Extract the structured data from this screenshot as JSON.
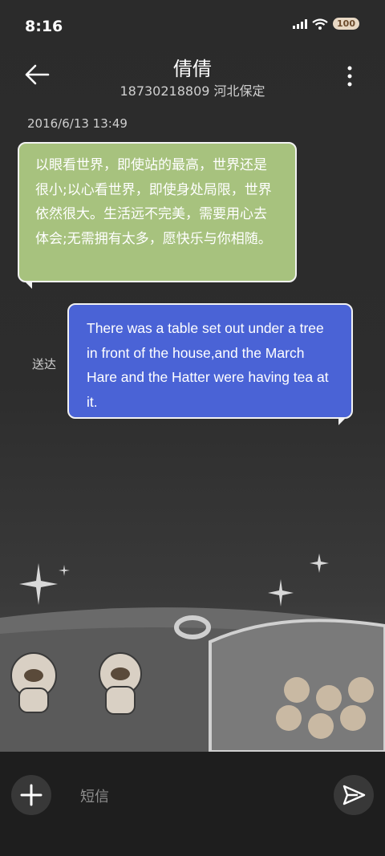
{
  "status_bar": {
    "time": "8:16",
    "battery_level": "100",
    "icons": [
      "signal-icon",
      "wifi-icon",
      "battery-icon"
    ]
  },
  "header": {
    "contact_name": "倩倩",
    "subtitle": "18730218809 河北保定",
    "back_icon": "back-arrow-icon",
    "menu_icon": "more-vertical-icon"
  },
  "messages": [
    {
      "direction": "incoming",
      "timestamp": "2016/6/13 13:49",
      "text": "以眼看世界，即使站的最高，世界还是很小;以心看世界，即使身处局限，世界依然很大。生活远不完美，需要用心去体会;无需拥有太多，愿快乐与你相随。"
    },
    {
      "direction": "outgoing",
      "status": "送达",
      "text": "There was a table set out under a tree in front of the house,and the March Hare and the Hatter were having tea at it."
    }
  ],
  "composer": {
    "placeholder": "短信",
    "add_icon": "plus-icon",
    "send_icon": "send-icon"
  },
  "colors": {
    "incoming_bubble": "#a7c27e",
    "outgoing_bubble": "#4a63d6",
    "background": "#2d2d2d",
    "bottom_bar": "#1e1e1e"
  }
}
